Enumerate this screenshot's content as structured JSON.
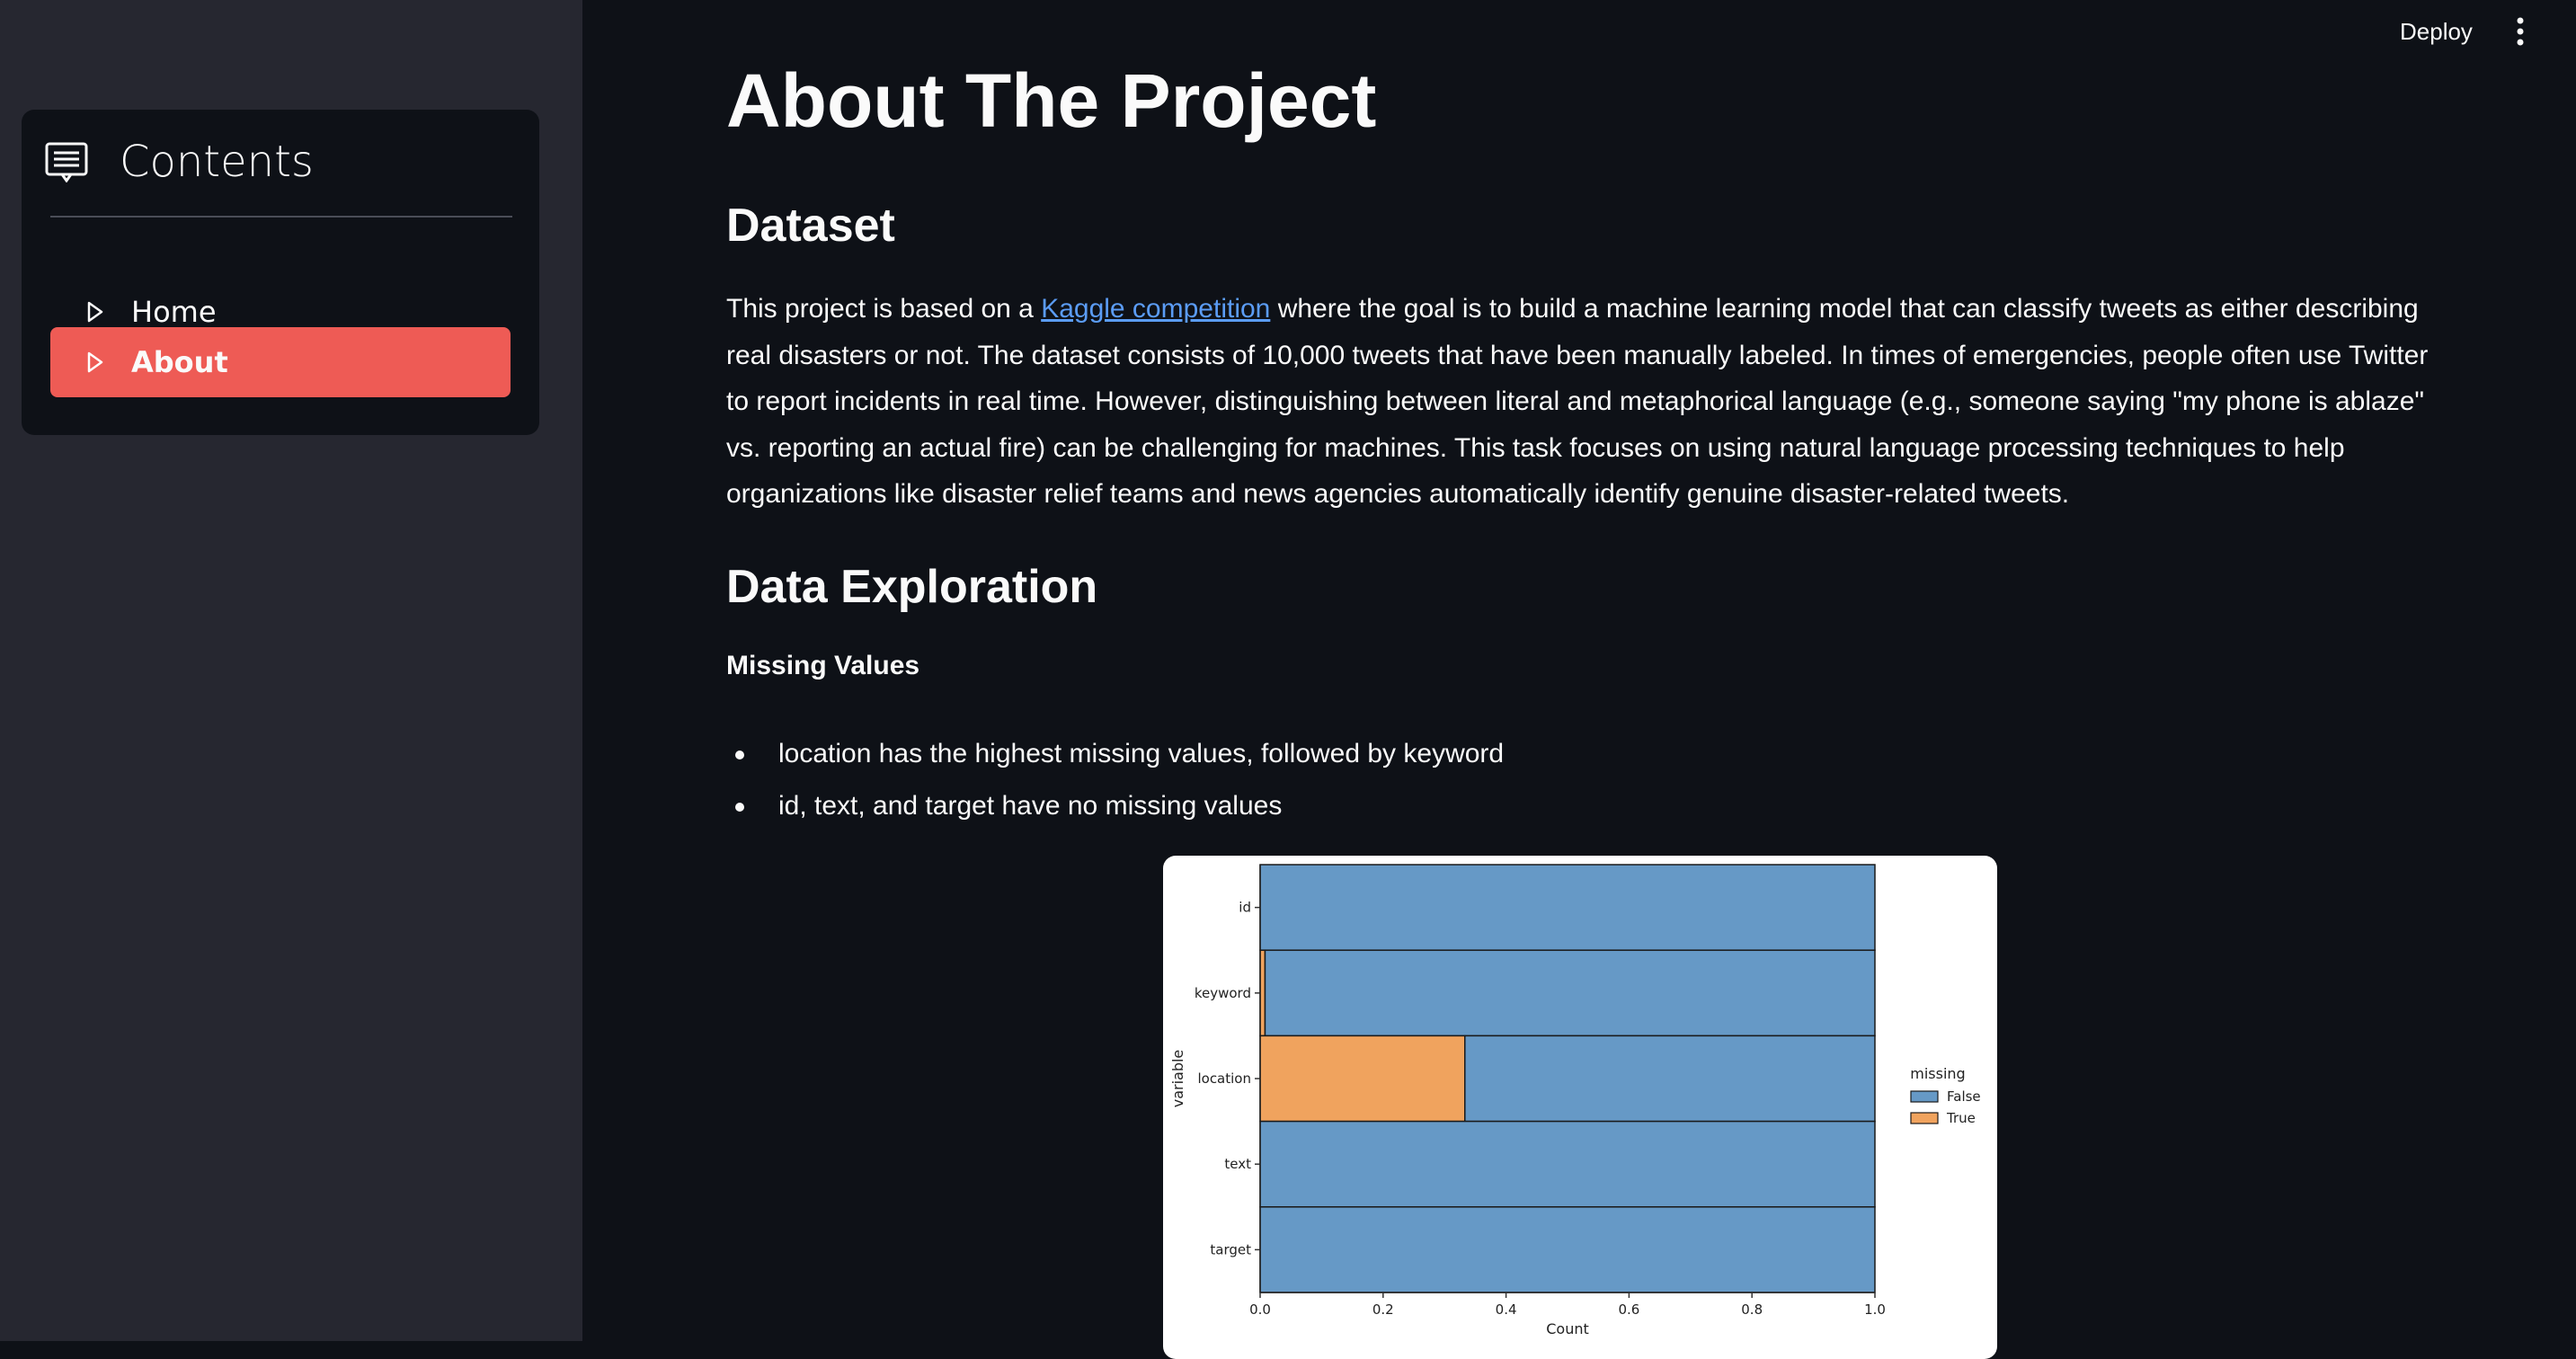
{
  "sidebar": {
    "menu_title": "Contents",
    "menu_icon": "list-doc-icon",
    "items": [
      {
        "label": "Home",
        "icon": "triangle-right-icon",
        "selected": false
      },
      {
        "label": "About",
        "icon": "triangle-right-icon",
        "selected": true
      }
    ],
    "accent_color": "#ee5b55"
  },
  "toolbar": {
    "deploy_label": "Deploy",
    "menu_icon": "vertical-dots-icon"
  },
  "main": {
    "title": "About The Project",
    "dataset_heading": "Dataset",
    "desc_before_link": "This project is based on a ",
    "desc_link": "Kaggle competition",
    "desc_after_link": " where the goal is to build a machine learning model that can classify tweets as either describing real disasters or not. The dataset consists of 10,000 tweets that have been manually labeled. In times of emergencies, people often use Twitter to report incidents in real time. However, distinguishing between literal and metaphorical language (e.g., someone saying \"my phone is ablaze\" vs. reporting an actual fire) can be challenging for machines. This task focuses on using natural language processing techniques to help organizations like disaster relief teams and news agencies automatically identify genuine disaster-related tweets.",
    "exploration_heading": "Data Exploration",
    "missing_heading": "Missing Values",
    "bullets": [
      "location has the highest missing values, followed by keyword",
      "id, text, and target have no missing values"
    ]
  },
  "chart_data": {
    "type": "bar",
    "orientation": "horizontal",
    "stacked": true,
    "categories": [
      "id",
      "keyword",
      "location",
      "text",
      "target"
    ],
    "series": [
      {
        "name": "True",
        "values": [
          0.0,
          0.008,
          0.333,
          0.0,
          0.0
        ],
        "color": "#f0a35e"
      },
      {
        "name": "False",
        "values": [
          1.0,
          0.992,
          0.667,
          1.0,
          1.0
        ],
        "color": "#6699c6"
      }
    ],
    "xlabel": "Count",
    "ylabel": "variable",
    "xlim": [
      0.0,
      1.0
    ],
    "xticks": [
      "0.0",
      "0.2",
      "0.4",
      "0.6",
      "0.8",
      "1.0"
    ],
    "legend_title": "missing",
    "legend_entries": [
      "False",
      "True"
    ],
    "legend_position": "right"
  }
}
